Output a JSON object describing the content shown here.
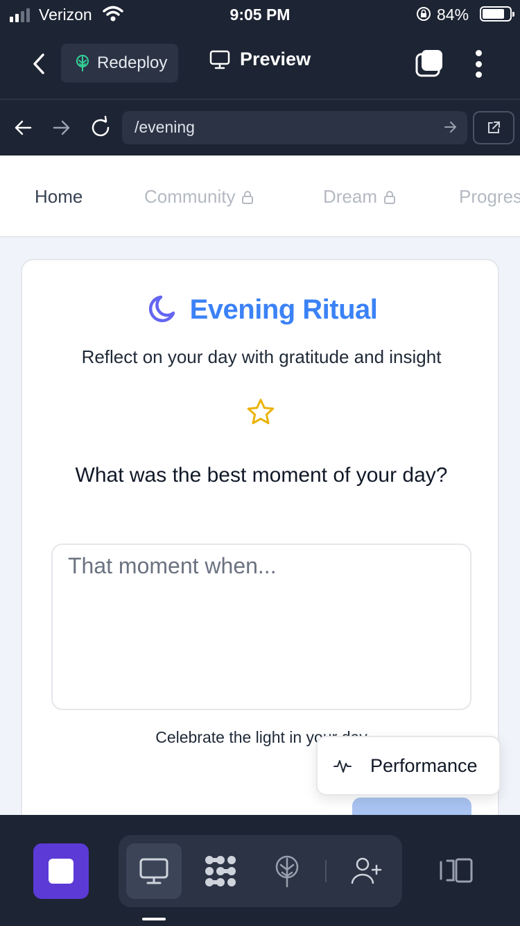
{
  "status_bar": {
    "carrier": "Verizon",
    "time": "9:05 PM",
    "battery": "84%"
  },
  "app_bar": {
    "redeploy_label": "Redeploy",
    "preview_label": "Preview"
  },
  "url_bar": {
    "path": "/evening"
  },
  "nav_tabs": [
    {
      "label": "Home",
      "locked": false
    },
    {
      "label": "Community",
      "locked": true
    },
    {
      "label": "Dream",
      "locked": true
    },
    {
      "label": "Progres",
      "locked": false
    }
  ],
  "card": {
    "title": "Evening Ritual",
    "subtitle": "Reflect on your day with gratitude and insight",
    "question": "What was the best moment of your day?",
    "answer_placeholder": "That moment when...",
    "hint": "Celebrate the light in your day"
  },
  "popover": {
    "performance_label": "Performance"
  },
  "colors": {
    "accent": "#3b82f6",
    "moon": "#6366f1",
    "star": "#eab308",
    "stop_button": "#5b3ad6",
    "chrome": "#1d2433"
  }
}
